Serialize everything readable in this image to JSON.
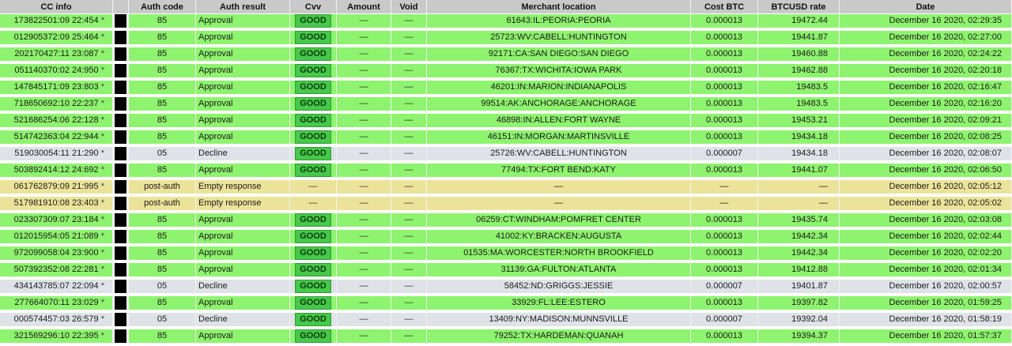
{
  "columns": [
    "CC info",
    "",
    "Auth code",
    "Auth result",
    "Cvv",
    "Amount",
    "Void",
    "Merchant location",
    "Cost BTC",
    "BTCUSD rate",
    "Date"
  ],
  "dash": "—",
  "star": "*",
  "rows": [
    {
      "status": "approval",
      "cc": "173822501:09 22:454",
      "auth_code": "85",
      "auth_result": "Approval",
      "cvv": "GOOD",
      "amount": "—",
      "void": "—",
      "merchant": "61643:IL:PEORIA:PEORIA",
      "cost": "0.000013",
      "rate": "19472.44",
      "date": "December 16 2020, 02:29:35"
    },
    {
      "status": "approval",
      "cc": "012905372:09 25:464",
      "auth_code": "85",
      "auth_result": "Approval",
      "cvv": "GOOD",
      "amount": "—",
      "void": "—",
      "merchant": "25723:WV:CABELL:HUNTINGTON",
      "cost": "0.000013",
      "rate": "19441.87",
      "date": "December 16 2020, 02:27:00"
    },
    {
      "status": "approval",
      "cc": "202170427:11 23:087",
      "auth_code": "85",
      "auth_result": "Approval",
      "cvv": "GOOD",
      "amount": "—",
      "void": "—",
      "merchant": "92171:CA:SAN DIEGO:SAN DIEGO",
      "cost": "0.000013",
      "rate": "19460.88",
      "date": "December 16 2020, 02:24:22"
    },
    {
      "status": "approval",
      "cc": "051140370:02 24:950",
      "auth_code": "85",
      "auth_result": "Approval",
      "cvv": "GOOD",
      "amount": "—",
      "void": "—",
      "merchant": "76367:TX:WICHITA:IOWA PARK",
      "cost": "0.000013",
      "rate": "19462.88",
      "date": "December 16 2020, 02:20:18"
    },
    {
      "status": "approval",
      "cc": "147845171:09 23:803",
      "auth_code": "85",
      "auth_result": "Approval",
      "cvv": "GOOD",
      "amount": "—",
      "void": "—",
      "merchant": "46201:IN:MARION:INDIANAPOLIS",
      "cost": "0.000013",
      "rate": "19483.5",
      "date": "December 16 2020, 02:16:47"
    },
    {
      "status": "approval",
      "cc": "718650692:10 22:237",
      "auth_code": "85",
      "auth_result": "Approval",
      "cvv": "GOOD",
      "amount": "—",
      "void": "—",
      "merchant": "99514:AK:ANCHORAGE:ANCHORAGE",
      "cost": "0.000013",
      "rate": "19483.5",
      "date": "December 16 2020, 02:16:20"
    },
    {
      "status": "approval",
      "cc": "521686254:06 22:128",
      "auth_code": "85",
      "auth_result": "Approval",
      "cvv": "GOOD",
      "amount": "—",
      "void": "—",
      "merchant": "46898:IN:ALLEN:FORT WAYNE",
      "cost": "0.000013",
      "rate": "19453.21",
      "date": "December 16 2020, 02:09:21"
    },
    {
      "status": "approval",
      "cc": "514742363:04 22:944",
      "auth_code": "85",
      "auth_result": "Approval",
      "cvv": "GOOD",
      "amount": "—",
      "void": "—",
      "merchant": "46151:IN:MORGAN:MARTINSVILLE",
      "cost": "0.000013",
      "rate": "19434.18",
      "date": "December 16 2020, 02:08:25"
    },
    {
      "status": "decline",
      "cc": "519030054:11 21:290",
      "auth_code": "05",
      "auth_result": "Decline",
      "cvv": "GOOD",
      "amount": "—",
      "void": "—",
      "merchant": "25726:WV:CABELL:HUNTINGTON",
      "cost": "0.000007",
      "rate": "19434.18",
      "date": "December 16 2020, 02:08:07"
    },
    {
      "status": "approval",
      "cc": "503892414:12 24:692",
      "auth_code": "85",
      "auth_result": "Approval",
      "cvv": "GOOD",
      "amount": "—",
      "void": "—",
      "merchant": "77494:TX:FORT BEND:KATY",
      "cost": "0.000013",
      "rate": "19441.07",
      "date": "December 16 2020, 02:06:50"
    },
    {
      "status": "empty",
      "cc": "061762879:09 21:995",
      "auth_code": "post-auth",
      "auth_result": "Empty response",
      "cvv": "—",
      "amount": "—",
      "void": "—",
      "merchant": "—",
      "cost": "—",
      "rate": "—",
      "date": "December 16 2020, 02:05:12"
    },
    {
      "status": "empty",
      "cc": "517981910:08 23:403",
      "auth_code": "post-auth",
      "auth_result": "Empty response",
      "cvv": "—",
      "amount": "—",
      "void": "—",
      "merchant": "—",
      "cost": "—",
      "rate": "—",
      "date": "December 16 2020, 02:05:02"
    },
    {
      "status": "approval",
      "cc": "023307309:07 23:184",
      "auth_code": "85",
      "auth_result": "Approval",
      "cvv": "GOOD",
      "amount": "—",
      "void": "—",
      "merchant": "06259:CT:WINDHAM:POMFRET CENTER",
      "cost": "0.000013",
      "rate": "19435.74",
      "date": "December 16 2020, 02:03:08"
    },
    {
      "status": "approval",
      "cc": "012015954:05 21:089",
      "auth_code": "85",
      "auth_result": "Approval",
      "cvv": "GOOD",
      "amount": "—",
      "void": "—",
      "merchant": "41002:KY:BRACKEN:AUGUSTA",
      "cost": "0.000013",
      "rate": "19442.34",
      "date": "December 16 2020, 02:02:44"
    },
    {
      "status": "approval",
      "cc": "972099058:04 23:900",
      "auth_code": "85",
      "auth_result": "Approval",
      "cvv": "GOOD",
      "amount": "—",
      "void": "—",
      "merchant": "01535:MA:WORCESTER:NORTH BROOKFIELD",
      "cost": "0.000013",
      "rate": "19442.34",
      "date": "December 16 2020, 02:02:20"
    },
    {
      "status": "approval",
      "cc": "507392352:08 22:281",
      "auth_code": "85",
      "auth_result": "Approval",
      "cvv": "GOOD",
      "amount": "—",
      "void": "—",
      "merchant": "31139:GA:FULTON:ATLANTA",
      "cost": "0.000013",
      "rate": "19412.88",
      "date": "December 16 2020, 02:01:34"
    },
    {
      "status": "decline",
      "cc": "434143785:07 22:094",
      "auth_code": "05",
      "auth_result": "Decline",
      "cvv": "GOOD",
      "amount": "—",
      "void": "—",
      "merchant": "58452:ND:GRIGGS:JESSIE",
      "cost": "0.000007",
      "rate": "19401.87",
      "date": "December 16 2020, 02:00:57"
    },
    {
      "status": "approval",
      "cc": "277664070:11 23:029",
      "auth_code": "85",
      "auth_result": "Approval",
      "cvv": "GOOD",
      "amount": "—",
      "void": "—",
      "merchant": "33929:FL:LEE:ESTERO",
      "cost": "0.000013",
      "rate": "19397.82",
      "date": "December 16 2020, 01:59:25"
    },
    {
      "status": "decline",
      "cc": "000574457:03 26:579",
      "auth_code": "05",
      "auth_result": "Decline",
      "cvv": "GOOD",
      "amount": "—",
      "void": "—",
      "merchant": "13409:NY:MADISON:MUNNSVILLE",
      "cost": "0.000007",
      "rate": "19392.04",
      "date": "December 16 2020, 01:58:19"
    },
    {
      "status": "approval",
      "cc": "321569296:10 22:395",
      "auth_code": "85",
      "auth_result": "Approval",
      "cvv": "GOOD",
      "amount": "—",
      "void": "—",
      "merchant": "79252:TX:HARDEMAN:QUANAH",
      "cost": "0.000013",
      "rate": "19394.37",
      "date": "December 16 2020, 01:57:37"
    }
  ]
}
